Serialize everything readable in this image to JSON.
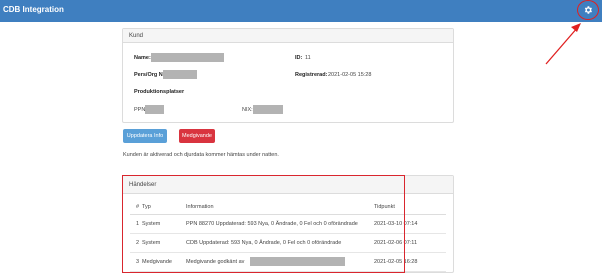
{
  "app": {
    "title": "CDB Integration",
    "settings_icon": "gear-icon"
  },
  "kund": {
    "header": "Kund",
    "name_label": "Name:",
    "persorg_label": "Pers/Org Nr:",
    "id_label": "ID:",
    "id_value": "11",
    "registered_label": "Registrerad:",
    "registered_value": "2021-02-05 15:28",
    "production_heading": "Produktionsplatser",
    "ppn_label": "PPN:",
    "nor_label": "NIX:"
  },
  "actions": {
    "update_label": "Uppdatera Info",
    "consent_label": "Medgivande"
  },
  "notice": "Kunden är aktiverad och djurdata kommer hämtas under natten.",
  "events": {
    "header": "Händelser",
    "columns": [
      "#",
      "Typ",
      "Information",
      "Tidpunkt"
    ],
    "rows": [
      {
        "nr": "1",
        "typ": "System",
        "info": "PPN 88270 Uppdaterad: 593 Nya, 0 Ändrade, 0 Fel och 0 oförändrade",
        "tid": "2021-03-10 07:14"
      },
      {
        "nr": "2",
        "typ": "System",
        "info": "CDB Uppdaterad: 593 Nya, 0 Ändrade, 0 Fel och 0 oförändrade",
        "tid": "2021-02-06 07:11"
      },
      {
        "nr": "3",
        "typ": "Medgivande",
        "info": "Medgivande godkänt av",
        "tid": "2021-02-05 16:28"
      }
    ]
  },
  "colors": {
    "topbar": "#3f7fc0",
    "primary_button": "#5aa0d8",
    "danger_button": "#d9343f",
    "annotation": "#e02020"
  }
}
